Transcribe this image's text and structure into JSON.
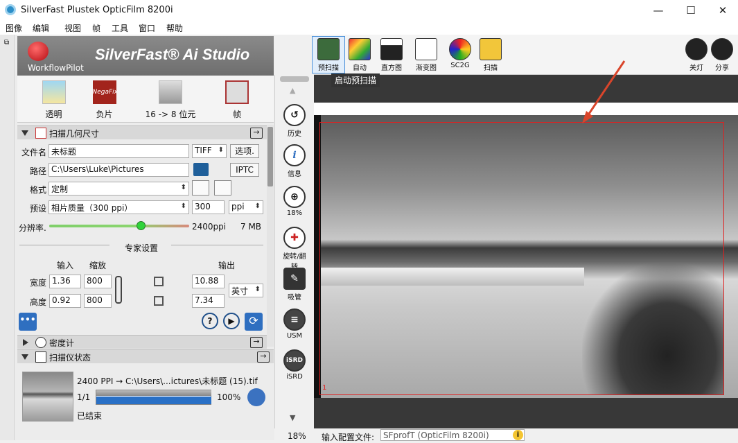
{
  "window": {
    "title": "SilverFast Plustek OpticFilm 8200i",
    "minimize": "—",
    "maximize": "☐",
    "close": "✕"
  },
  "menu": [
    "图像",
    "编辑",
    "视图",
    "帧",
    "工具",
    "窗口",
    "帮助"
  ],
  "workflow": {
    "logo_sub": "WorkflowPilot",
    "app_title": "SilverFast® Ai Studio"
  },
  "modes": [
    {
      "label": "透明",
      "icon": "transparent-icon"
    },
    {
      "label": "负片",
      "icon": "negafix-icon"
    },
    {
      "label": "16 -> 8 位元",
      "icon": "bitdepth-icon"
    },
    {
      "label": "帧",
      "icon": "frame-tools-icon"
    }
  ],
  "negafix_text": "NegaFix",
  "scan_geometry": {
    "title": "扫描几何尺寸",
    "filename_label": "文件名",
    "filename_value": "未标题",
    "format_value": "TIFF",
    "options_button": "选项.",
    "path_label": "路径",
    "path_value": "C:\\Users\\Luke\\Pictures",
    "iptc_button": "IPTC",
    "format_label": "格式",
    "format_select": "定制",
    "preset_label": "预设",
    "preset_select": "相片质量（300 ppi）",
    "ppi_value": "300",
    "ppi_unit": "ppi",
    "resolution_label": "分辨率.",
    "resolution_value": "2400ppi",
    "resolution_level": 0.62,
    "file_size": "7 MB",
    "expert_title": "专家设置",
    "col_input": "输入",
    "col_scale": "缩放",
    "col_output": "输出",
    "width_label": "宽度",
    "width_in": "1.36",
    "width_scale": "800",
    "width_out": "10.88",
    "height_label": "高度",
    "height_in": "0.92",
    "height_scale": "800",
    "height_out": "7.34",
    "unit_select": "英寸"
  },
  "densitometer": {
    "title": "密度计"
  },
  "scanner_status": {
    "title": "扫描仪状态",
    "line": "2400 PPI → C:\\Users\\...ictures\\未标题 (15).tif",
    "count": "1/1",
    "percent": "100%",
    "progress": 1.0,
    "state": "已结束"
  },
  "tools": [
    {
      "label": "历史",
      "icon": "history-icon"
    },
    {
      "label": "信息",
      "icon": "info-icon"
    },
    {
      "label": "18%",
      "icon": "zoom-icon"
    },
    {
      "label": "旋转/翻转",
      "icon": "rotate-flip-icon"
    },
    {
      "label": "吸管",
      "icon": "eyedropper-icon"
    },
    {
      "label": "USM",
      "icon": "usm-icon"
    },
    {
      "label": "iSRD",
      "icon": "isrd-icon"
    }
  ],
  "toolbar": [
    {
      "label": "预扫描",
      "icon": "prescan-icon"
    },
    {
      "label": "自动",
      "icon": "auto-icon"
    },
    {
      "label": "直方图",
      "icon": "histogram-icon"
    },
    {
      "label": "渐变图",
      "icon": "gradation-icon"
    },
    {
      "label": "SC2G",
      "icon": "sc2g-icon"
    },
    {
      "label": "扫描",
      "icon": "scan-icon"
    }
  ],
  "toolbar_right": [
    {
      "label": "关灯",
      "icon": "light-off-icon"
    },
    {
      "label": "分享",
      "icon": "share-icon"
    }
  ],
  "tooltip": "启动预扫描",
  "frame_number": "1",
  "status": {
    "zoom": "18%",
    "profile_label": "输入配置文件:",
    "profile_value": "SFprofT (OpticFilm 8200i)"
  },
  "colors": {
    "accent": "#2970c6",
    "frame": "#e02020",
    "arrow": "#d9452b"
  }
}
